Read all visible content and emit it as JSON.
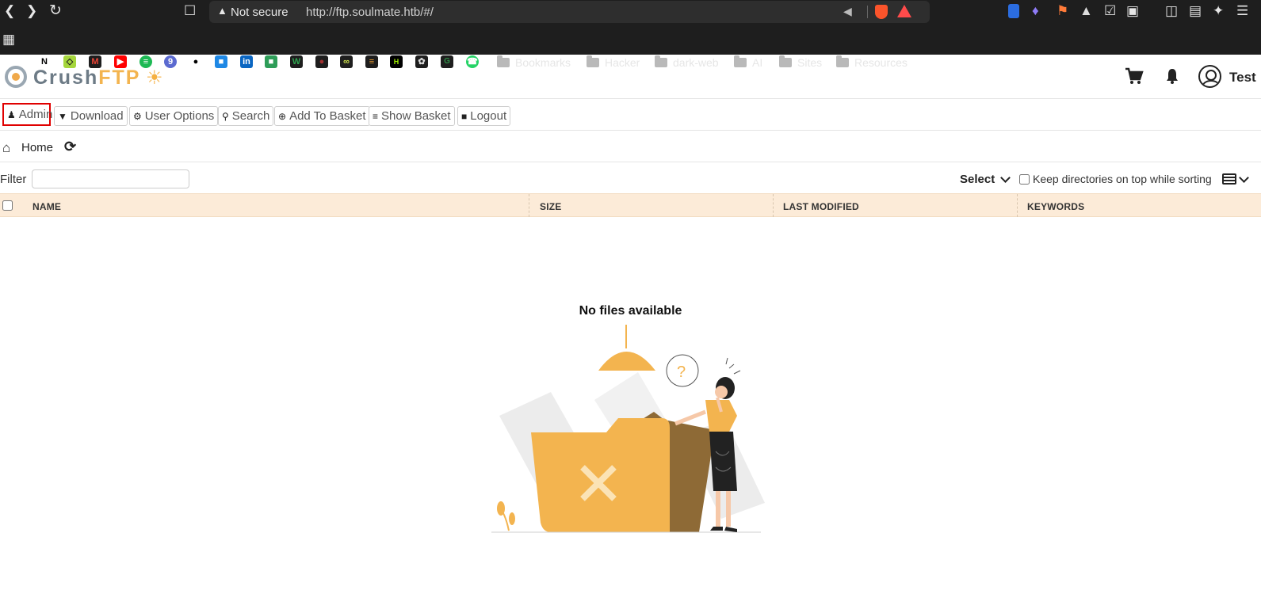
{
  "browser": {
    "security_label": "Not secure",
    "url": "http://ftp.soulmate.htb/#/",
    "bookmark_folders": [
      "Bookmarks",
      "Hacker",
      "dark-web",
      "AI",
      "Sites",
      "Resources"
    ]
  },
  "app": {
    "logo_crush": "Crush",
    "logo_ftp": "FTP",
    "username": "Test"
  },
  "toolbar": {
    "admin": "Admin",
    "download": "Download",
    "user_options": "User Options",
    "search": "Search",
    "add_to_basket": "Add To Basket",
    "show_basket": "Show Basket",
    "logout": "Logout"
  },
  "breadcrumb": {
    "home": "Home"
  },
  "filter": {
    "label": "Filter",
    "value": "",
    "placeholder": ""
  },
  "view": {
    "select_label": "Select",
    "keep_dirs_label": "Keep directories on top while sorting"
  },
  "table": {
    "columns": [
      "NAME",
      "SIZE",
      "LAST MODIFIED",
      "KEYWORDS"
    ]
  },
  "empty_state": {
    "message": "No files available"
  },
  "colors": {
    "accent_orange": "#f3b44f",
    "header_bg": "#fcebd8",
    "highlight_red": "#e00000"
  }
}
